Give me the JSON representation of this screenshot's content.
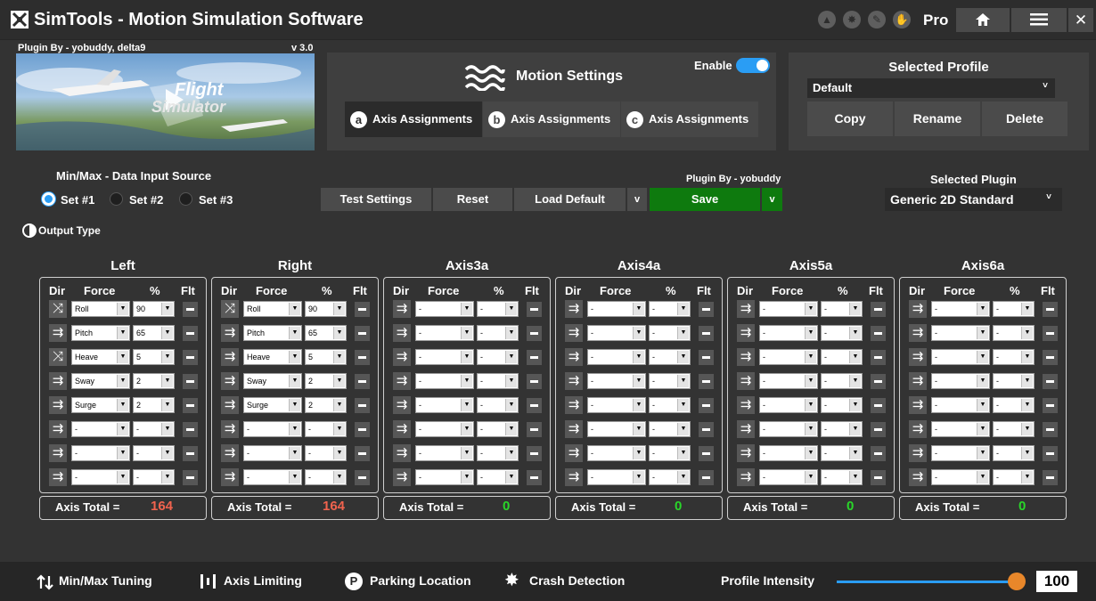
{
  "header": {
    "title": "SimTools - Motion Simulation Software",
    "edition": "Pro",
    "home_icon": "home-icon",
    "menu_icon": "menu-icon",
    "close_label": "✕"
  },
  "plugin_preview": {
    "author": "Plugin By - yobuddy, delta9",
    "version": "v 3.0",
    "image_caption_top": "Flight",
    "image_caption_bottom": "Simulator"
  },
  "motion_settings": {
    "title": "Motion Settings",
    "enable_label": "Enable",
    "enabled": true,
    "tabs": [
      {
        "letter": "a",
        "label": "Axis Assignments"
      },
      {
        "letter": "b",
        "label": "Axis Assignments"
      },
      {
        "letter": "c",
        "label": "Axis Assignments"
      }
    ]
  },
  "profile": {
    "title": "Selected Profile",
    "value": "Default",
    "buttons": [
      "Copy",
      "Rename",
      "Delete"
    ]
  },
  "input_source": {
    "title": "Min/Max - Data Input Source",
    "options": [
      "Set #1",
      "Set #2",
      "Set #3"
    ],
    "selected": 0
  },
  "toolbar": {
    "test_settings": "Test Settings",
    "reset": "Reset",
    "load_default": "Load Default",
    "load_dropdown": "v",
    "plugin_by": "Plugin By - yobuddy",
    "save": "Save",
    "save_dropdown": "v"
  },
  "plugin_select": {
    "title": "Selected Plugin",
    "value": "Generic 2D Standard",
    "caret": "˅"
  },
  "output_type": "Output Type",
  "columns": {
    "dir": "Dir",
    "force": "Force",
    "pct": "%",
    "flt": "Flt"
  },
  "total_label": "Axis Total =",
  "colors": {
    "total_nonzero": "#f0634e",
    "total_zero": "#29d629",
    "accent": "#2a9df4",
    "save_green": "#0e7a0e",
    "slider_knob": "#e8872a"
  },
  "axes": [
    {
      "name": "Left",
      "total": "164",
      "rows": [
        {
          "dir": "cross",
          "force": "Roll",
          "pct": "90"
        },
        {
          "dir": "arrow",
          "force": "Pitch",
          "pct": "65"
        },
        {
          "dir": "cross",
          "force": "Heave",
          "pct": "5"
        },
        {
          "dir": "arrow",
          "force": "Sway",
          "pct": "2"
        },
        {
          "dir": "arrow",
          "force": "Surge",
          "pct": "2"
        },
        {
          "dir": "arrow",
          "force": "-",
          "pct": "-"
        },
        {
          "dir": "arrow",
          "force": "-",
          "pct": "-"
        },
        {
          "dir": "arrow",
          "force": "-",
          "pct": "-"
        }
      ]
    },
    {
      "name": "Right",
      "total": "164",
      "rows": [
        {
          "dir": "cross",
          "force": "Roll",
          "pct": "90"
        },
        {
          "dir": "arrow",
          "force": "Pitch",
          "pct": "65"
        },
        {
          "dir": "arrow",
          "force": "Heave",
          "pct": "5"
        },
        {
          "dir": "arrow",
          "force": "Sway",
          "pct": "2"
        },
        {
          "dir": "arrow",
          "force": "Surge",
          "pct": "2"
        },
        {
          "dir": "arrow",
          "force": "-",
          "pct": "-"
        },
        {
          "dir": "arrow",
          "force": "-",
          "pct": "-"
        },
        {
          "dir": "arrow",
          "force": "-",
          "pct": "-"
        }
      ]
    },
    {
      "name": "Axis3a",
      "total": "0",
      "rows": [
        {
          "dir": "arrow",
          "force": "-",
          "pct": "-"
        },
        {
          "dir": "arrow",
          "force": "-",
          "pct": "-"
        },
        {
          "dir": "arrow",
          "force": "-",
          "pct": "-"
        },
        {
          "dir": "arrow",
          "force": "-",
          "pct": "-"
        },
        {
          "dir": "arrow",
          "force": "-",
          "pct": "-"
        },
        {
          "dir": "arrow",
          "force": "-",
          "pct": "-"
        },
        {
          "dir": "arrow",
          "force": "-",
          "pct": "-"
        },
        {
          "dir": "arrow",
          "force": "-",
          "pct": "-"
        }
      ]
    },
    {
      "name": "Axis4a",
      "total": "0",
      "rows": [
        {
          "dir": "arrow",
          "force": "-",
          "pct": "-"
        },
        {
          "dir": "arrow",
          "force": "-",
          "pct": "-"
        },
        {
          "dir": "arrow",
          "force": "-",
          "pct": "-"
        },
        {
          "dir": "arrow",
          "force": "-",
          "pct": "-"
        },
        {
          "dir": "arrow",
          "force": "-",
          "pct": "-"
        },
        {
          "dir": "arrow",
          "force": "-",
          "pct": "-"
        },
        {
          "dir": "arrow",
          "force": "-",
          "pct": "-"
        },
        {
          "dir": "arrow",
          "force": "-",
          "pct": "-"
        }
      ]
    },
    {
      "name": "Axis5a",
      "total": "0",
      "rows": [
        {
          "dir": "arrow",
          "force": "-",
          "pct": "-"
        },
        {
          "dir": "arrow",
          "force": "-",
          "pct": "-"
        },
        {
          "dir": "arrow",
          "force": "-",
          "pct": "-"
        },
        {
          "dir": "arrow",
          "force": "-",
          "pct": "-"
        },
        {
          "dir": "arrow",
          "force": "-",
          "pct": "-"
        },
        {
          "dir": "arrow",
          "force": "-",
          "pct": "-"
        },
        {
          "dir": "arrow",
          "force": "-",
          "pct": "-"
        },
        {
          "dir": "arrow",
          "force": "-",
          "pct": "-"
        }
      ]
    },
    {
      "name": "Axis6a",
      "total": "0",
      "rows": [
        {
          "dir": "arrow",
          "force": "-",
          "pct": "-"
        },
        {
          "dir": "arrow",
          "force": "-",
          "pct": "-"
        },
        {
          "dir": "arrow",
          "force": "-",
          "pct": "-"
        },
        {
          "dir": "arrow",
          "force": "-",
          "pct": "-"
        },
        {
          "dir": "arrow",
          "force": "-",
          "pct": "-"
        },
        {
          "dir": "arrow",
          "force": "-",
          "pct": "-"
        },
        {
          "dir": "arrow",
          "force": "-",
          "pct": "-"
        },
        {
          "dir": "arrow",
          "force": "-",
          "pct": "-"
        }
      ]
    }
  ],
  "footer": {
    "minmax": "Min/Max Tuning",
    "axis_limiting": "Axis Limiting",
    "parking": "Parking Location",
    "crash": "Crash Detection",
    "intensity_label": "Profile Intensity",
    "intensity_value": "100",
    "intensity_level": 1.0
  }
}
